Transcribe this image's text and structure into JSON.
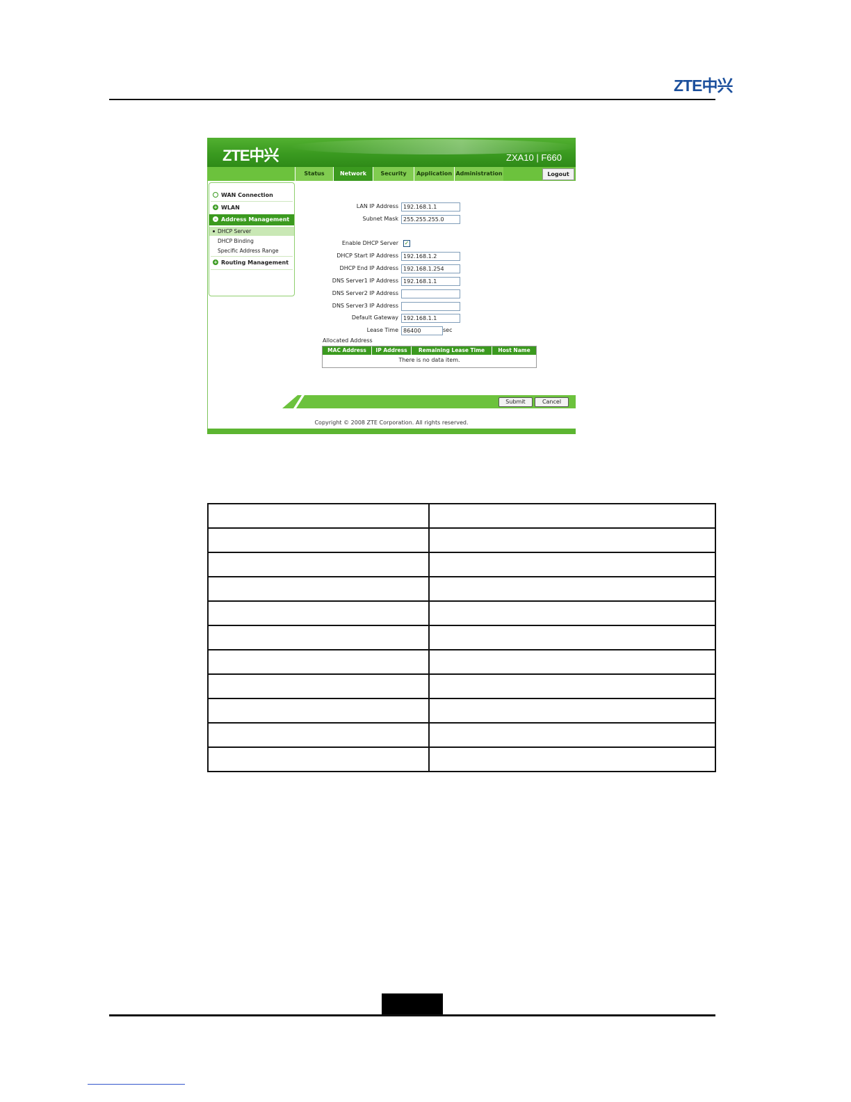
{
  "document": {
    "logo": "ZTE中兴"
  },
  "app": {
    "logo": "ZTE中兴",
    "product": "ZXA10 | F660"
  },
  "nav": {
    "tabs": [
      "Status",
      "Network",
      "Security",
      "Application",
      "Administration"
    ],
    "active_tab": "Network",
    "logout": "Logout"
  },
  "sidebar": {
    "items": [
      {
        "label": "WAN Connection",
        "state": "collapsed"
      },
      {
        "label": "WLAN",
        "state": "collapsed"
      },
      {
        "label": "Address Management",
        "state": "expanded"
      },
      {
        "label": "Routing Management",
        "state": "collapsed"
      }
    ],
    "subitems": [
      {
        "label": "DHCP Server",
        "active": true
      },
      {
        "label": "DHCP Binding",
        "active": false
      },
      {
        "label": "Specific Address Range",
        "active": false
      }
    ]
  },
  "form": {
    "lan_ip": {
      "label": "LAN IP Address",
      "value": "192.168.1.1"
    },
    "subnet": {
      "label": "Subnet Mask",
      "value": "255.255.255.0"
    },
    "enable_dhcp": {
      "label": "Enable DHCP Server",
      "checked": true
    },
    "start_ip": {
      "label": "DHCP Start IP Address",
      "value": "192.168.1.2"
    },
    "end_ip": {
      "label": "DHCP End IP Address",
      "value": "192.168.1.254"
    },
    "dns1": {
      "label": "DNS Server1 IP Address",
      "value": "192.168.1.1"
    },
    "dns2": {
      "label": "DNS Server2 IP Address",
      "value": ""
    },
    "dns3": {
      "label": "DNS Server3 IP Address",
      "value": ""
    },
    "gateway": {
      "label": "Default Gateway",
      "value": "192.168.1.1"
    },
    "lease": {
      "label": "Lease Time",
      "value": "86400",
      "unit": "sec"
    }
  },
  "allocated": {
    "title": "Allocated Address",
    "columns": [
      "MAC Address",
      "IP Address",
      "Remaining Lease Time",
      "Host Name"
    ],
    "empty_text": "There is no data item."
  },
  "actions": {
    "submit": "Submit",
    "cancel": "Cancel"
  },
  "footer": {
    "copyright": "Copyright © 2008 ZTE Corporation. All rights reserved."
  },
  "param_table": {
    "rows": 11,
    "cells_empty": true
  },
  "colors": {
    "brand_green": "#3b9a1f",
    "nav_green": "#6cc23d",
    "zte_blue": "#1b4f9c"
  }
}
